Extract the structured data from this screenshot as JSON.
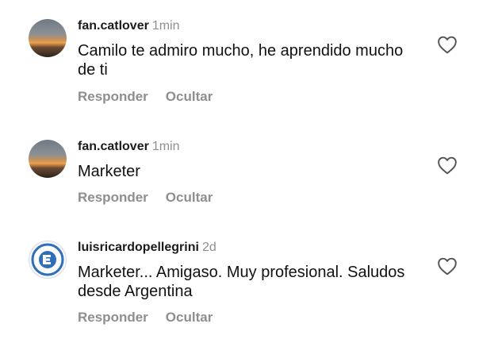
{
  "comments": [
    {
      "username": "fan.catlover",
      "time": "1min",
      "text": "Camilo te admiro mucho, he aprendido mucho de ti",
      "reply_label": "Responder",
      "hide_label": "Ocultar",
      "avatar": "sunset-photo",
      "like_icon": "heart-outline-icon"
    },
    {
      "username": "fan.catlover",
      "time": "1min",
      "text": "Marketer",
      "reply_label": "Responder",
      "hide_label": "Ocultar",
      "avatar": "sunset-photo",
      "like_icon": "heart-outline-icon"
    },
    {
      "username": "luisricardopellegrini",
      "time": "2d",
      "text": "Marketer... Amigaso. Muy profesional. Saludos desde Argentina",
      "reply_label": "Responder",
      "hide_label": "Ocultar",
      "avatar": "foundation-logo",
      "like_icon": "heart-outline-icon"
    }
  ],
  "colors": {
    "secondary_text": "#8e8e8e",
    "primary_text": "#111111",
    "logo_blue": "#2f6fb8"
  }
}
